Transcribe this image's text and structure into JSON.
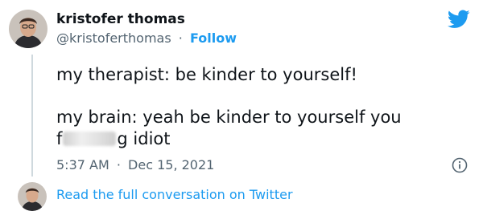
{
  "author": {
    "name": "kristofer thomas",
    "handle": "@kristoferthomas",
    "follow_label": "Follow",
    "separator": "·"
  },
  "tweet": {
    "line1": "my therapist: be kinder to yourself!",
    "line2": "my brain: yeah be kinder to yourself you",
    "line3_start": "f",
    "line3_end": "g idiot",
    "time": "5:37 AM",
    "separator": "·",
    "date": "Dec 15, 2021"
  },
  "footer": {
    "link_text": "Read the full conversation on Twitter"
  },
  "icons": {
    "logo": "twitter-bird-icon",
    "info": "info-icon"
  },
  "colors": {
    "accent": "#1d9bf0",
    "text": "#0f1419",
    "muted": "#536471",
    "line": "#cfd9de"
  }
}
